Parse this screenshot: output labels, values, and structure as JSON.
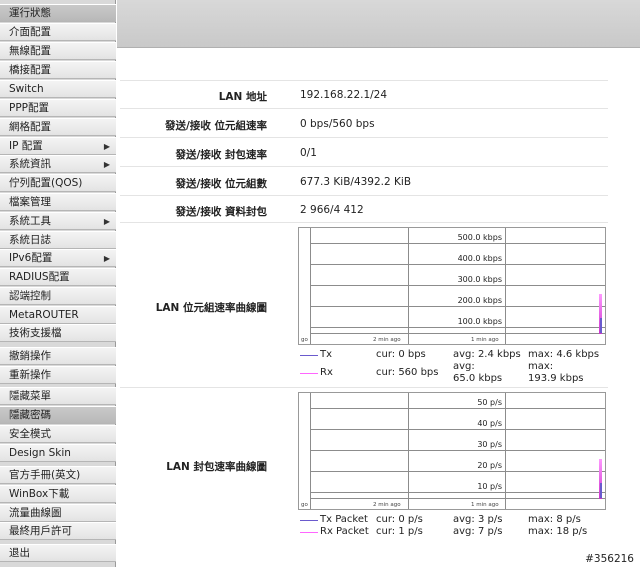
{
  "sidebar": {
    "items": [
      {
        "label": "運行狀態",
        "arrow": false,
        "active": true
      },
      {
        "label": "介面配置",
        "arrow": false
      },
      {
        "label": "無線配置",
        "arrow": false
      },
      {
        "label": "橋接配置",
        "arrow": false
      },
      {
        "label": "Switch",
        "arrow": false
      },
      {
        "label": "PPP配置",
        "arrow": false
      },
      {
        "label": "網格配置",
        "arrow": false
      },
      {
        "label": "IP 配置",
        "arrow": true
      },
      {
        "label": "系統資訊",
        "arrow": true
      },
      {
        "label": "佇列配置(QOS)",
        "arrow": false
      },
      {
        "label": "檔案管理",
        "arrow": false
      },
      {
        "label": "系統工具",
        "arrow": true
      },
      {
        "label": "系統日誌",
        "arrow": false
      },
      {
        "label": "IPv6配置",
        "arrow": true
      },
      {
        "label": "RADIUS配置",
        "arrow": false
      },
      {
        "label": "認端控制",
        "arrow": false
      },
      {
        "label": "MetaROUTER",
        "arrow": false
      },
      {
        "label": "技術支援檔",
        "arrow": false
      },
      {
        "label": "撤銷操作",
        "arrow": false
      },
      {
        "label": "重新操作",
        "arrow": false
      },
      {
        "label": "隱藏菜單",
        "arrow": false
      },
      {
        "label": "隱藏密碼",
        "arrow": false,
        "active": true
      },
      {
        "label": "安全模式",
        "arrow": false
      },
      {
        "label": "Design Skin",
        "arrow": false
      },
      {
        "label": "官方手冊(英文)",
        "arrow": false
      },
      {
        "label": "WinBox下載",
        "arrow": false
      },
      {
        "label": "流量曲線圖",
        "arrow": false
      },
      {
        "label": "最終用戶許可",
        "arrow": false
      },
      {
        "label": "退出",
        "arrow": false
      }
    ]
  },
  "info": {
    "lan_address_label": "LAN 地址",
    "lan_address_value": "192.168.22.1/24",
    "bit_rate_label": "發送/接收 位元組速率",
    "bit_rate_value": "0 bps/560 bps",
    "packet_rate_label": "發送/接收 封包速率",
    "packet_rate_value": "0/1",
    "bytes_label": "發送/接收 位元組數",
    "bytes_value": "677.3 KiB/4392.2 KiB",
    "packets_label": "發送/接收 資料封包",
    "packets_value": "2 966/4 412"
  },
  "bit_graph": {
    "label": "LAN 位元組速率曲線圖",
    "y_labels": [
      "500.0 kbps",
      "400.0 kbps",
      "300.0 kbps",
      "200.0 kbps",
      "100.0 kbps"
    ],
    "time_labels": [
      "go",
      "2 min ago",
      "1 min ago"
    ],
    "legend": {
      "tx": {
        "name": "Tx",
        "cur": "cur: 0 bps",
        "avg": "avg: 2.4 kbps",
        "max": "max: 4.6 kbps",
        "color": "#6a5acd"
      },
      "rx": {
        "name": "Rx",
        "cur": "cur: 560 bps",
        "avg1": "avg:",
        "avg2": "65.0 kbps",
        "max1": "max:",
        "max2": "193.9 kbps",
        "color": "#ff66ff"
      }
    }
  },
  "packet_graph": {
    "label": "LAN 封包速率曲線圖",
    "y_labels": [
      "50 p/s",
      "40 p/s",
      "30 p/s",
      "20 p/s",
      "10 p/s"
    ],
    "time_labels": [
      "go",
      "2 min ago",
      "1 min ago"
    ],
    "legend": {
      "tx": {
        "name": "Tx Packet",
        "cur": "cur: 0 p/s",
        "avg": "avg: 3 p/s",
        "max": "max: 8 p/s",
        "color": "#6a5acd"
      },
      "rx": {
        "name": "Rx Packet",
        "cur": "cur: 1 p/s",
        "avg": "avg: 7 p/s",
        "max": "max: 18 p/s",
        "color": "#ff66ff"
      }
    }
  },
  "watermark": "#356216"
}
